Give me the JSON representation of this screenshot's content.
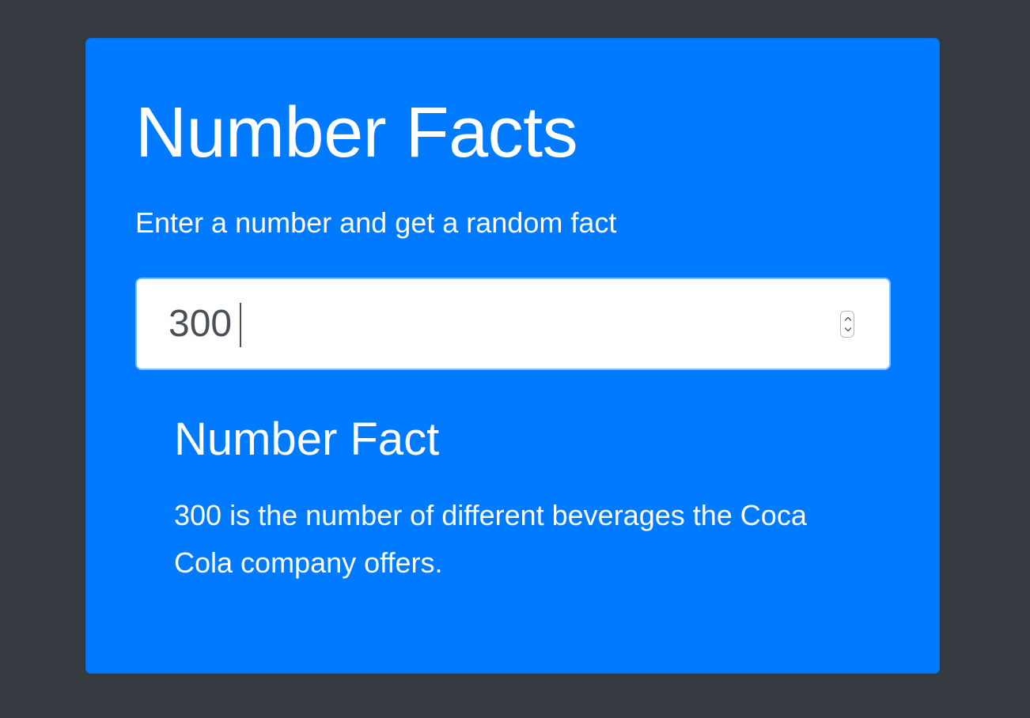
{
  "app": {
    "title": "Number Facts",
    "subtitle": "Enter a number and get a random fact"
  },
  "number_input": {
    "value": "300",
    "stepper_icon": "up-down-spinner-icon"
  },
  "fact": {
    "heading": "Number Fact",
    "text": "300 is the number of different beverages the Coca Cola company offers."
  },
  "colors": {
    "page_background": "#343a40",
    "card_background": "#007bff",
    "input_border_focus": "#80bdff",
    "input_text": "#495057",
    "text": "#ffffff"
  }
}
